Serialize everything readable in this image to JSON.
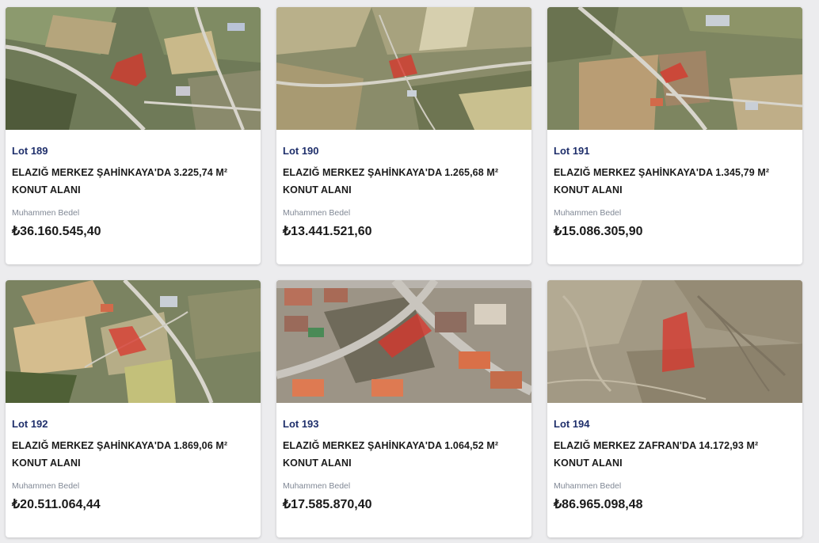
{
  "cards": [
    {
      "lot": "Lot 189",
      "title": "ELAZIĞ MERKEZ ŞAHİNKAYA'DA 3.225,74 M² KONUT ALANI",
      "price_label": "Muhammen Bedel",
      "price": "₺36.160.545,40"
    },
    {
      "lot": "Lot 190",
      "title": "ELAZIĞ MERKEZ ŞAHİNKAYA'DA 1.265,68 M² KONUT ALANI",
      "price_label": "Muhammen Bedel",
      "price": "₺13.441.521,60"
    },
    {
      "lot": "Lot 191",
      "title": "ELAZIĞ MERKEZ ŞAHİNKAYA'DA 1.345,79 M² KONUT ALANI",
      "price_label": "Muhammen Bedel",
      "price": "₺15.086.305,90"
    },
    {
      "lot": "Lot 192",
      "title": "ELAZIĞ MERKEZ ŞAHİNKAYA'DA 1.869,06 M² KONUT ALANI",
      "price_label": "Muhammen Bedel",
      "price": "₺20.511.064,44"
    },
    {
      "lot": "Lot 193",
      "title": "ELAZIĞ MERKEZ ŞAHİNKAYA'DA 1.064,52 M² KONUT ALANI",
      "price_label": "Muhammen Bedel",
      "price": "₺17.585.870,40"
    },
    {
      "lot": "Lot 194",
      "title": "ELAZIĞ MERKEZ ZAFRAN'DA 14.172,93 M² KONUT ALANI",
      "price_label": "Muhammen Bedel",
      "price": "₺86.965.098,48"
    }
  ],
  "colors": {
    "lot_text": "#1f2f6b",
    "parcel_highlight": "#d9342b",
    "page_background": "#ececee"
  },
  "icons": [
    "satellite-map-image"
  ]
}
